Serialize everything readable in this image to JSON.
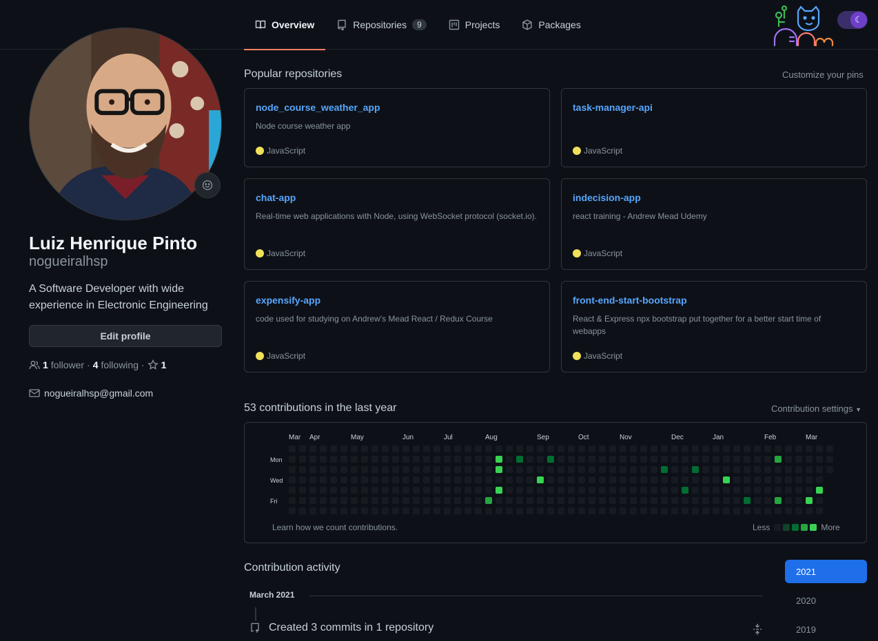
{
  "nav": {
    "tabs": [
      {
        "label": "Overview",
        "icon": "book-icon",
        "active": true
      },
      {
        "label": "Repositories",
        "icon": "repo-icon",
        "count": "9"
      },
      {
        "label": "Projects",
        "icon": "project-icon"
      },
      {
        "label": "Packages",
        "icon": "package-icon"
      }
    ]
  },
  "profile": {
    "full_name": "Luiz Henrique Pinto",
    "username": "nogueiralhsp",
    "bio": "A Software Developer with wide experience in Electronic Engineering",
    "edit_label": "Edit profile",
    "followers_count": "1",
    "followers_label": "follower",
    "following_count": "4",
    "following_label": "following",
    "stars_count": "1",
    "email": "nogueiralhsp@gmail.com"
  },
  "popular": {
    "title": "Popular repositories",
    "customize_label": "Customize your pins",
    "repos": [
      {
        "name": "node_course_weather_app",
        "description": "Node course weather app",
        "language": "JavaScript"
      },
      {
        "name": "task-manager-api",
        "description": "",
        "language": "JavaScript"
      },
      {
        "name": "chat-app",
        "description": "Real-time web applications with Node, using WebSocket protocol (socket.io).",
        "language": "JavaScript"
      },
      {
        "name": "indecision-app",
        "description": "react training - Andrew Mead Udemy",
        "language": "JavaScript"
      },
      {
        "name": "expensify-app",
        "description": "code used for studying on Andrew's Mead React / Redux Course",
        "language": "JavaScript"
      },
      {
        "name": "front-end-start-bootstrap",
        "description": "React & Express npx bootstrap put together for a better start time of webapps",
        "language": "JavaScript"
      }
    ]
  },
  "contributions": {
    "title": "53 contributions in the last year",
    "settings_label": "Contribution settings",
    "months": [
      "Mar",
      "Apr",
      "May",
      "Jun",
      "Jul",
      "Aug",
      "Sep",
      "Oct",
      "Nov",
      "Dec",
      "Jan",
      "Feb",
      "Mar"
    ],
    "weekdays": [
      "Mon",
      "Wed",
      "Fri"
    ],
    "learn_label": "Learn how we count contributions.",
    "less_label": "Less",
    "more_label": "More",
    "colors": [
      "#161b22",
      "#0e4429",
      "#006d32",
      "#26a641",
      "#39d353"
    ],
    "cells": [
      {
        "week": 20,
        "day": 1,
        "level": 4
      },
      {
        "week": 20,
        "day": 2,
        "level": 4
      },
      {
        "week": 20,
        "day": 4,
        "level": 4
      },
      {
        "week": 19,
        "day": 5,
        "level": 3
      },
      {
        "week": 22,
        "day": 1,
        "level": 2
      },
      {
        "week": 25,
        "day": 1,
        "level": 2
      },
      {
        "week": 24,
        "day": 3,
        "level": 4
      },
      {
        "week": 36,
        "day": 2,
        "level": 2
      },
      {
        "week": 38,
        "day": 4,
        "level": 2
      },
      {
        "week": 39,
        "day": 2,
        "level": 2
      },
      {
        "week": 42,
        "day": 3,
        "level": 4
      },
      {
        "week": 44,
        "day": 5,
        "level": 2
      },
      {
        "week": 47,
        "day": 1,
        "level": 3
      },
      {
        "week": 47,
        "day": 5,
        "level": 3
      },
      {
        "week": 50,
        "day": 5,
        "level": 4
      },
      {
        "week": 51,
        "day": 4,
        "level": 4
      },
      {
        "week": 52,
        "day": 3,
        "level": 2
      }
    ]
  },
  "activity": {
    "title": "Contribution activity",
    "years": [
      "2021",
      "2020",
      "2019"
    ],
    "month_label": "March 2021",
    "commit_summary": "Created 3 commits in 1 repository"
  }
}
